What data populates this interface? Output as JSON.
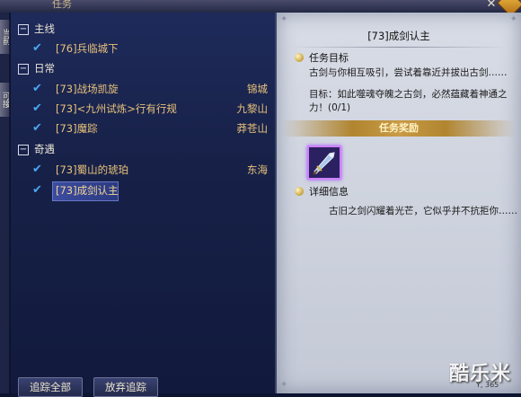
{
  "window": {
    "title_fragment": "任务",
    "close_glyph": "✕"
  },
  "side_tabs": [
    "当前",
    "可接"
  ],
  "categories": [
    {
      "label": "主线",
      "toggle": "−",
      "quests": [
        {
          "title": "[76]兵临城下",
          "location": ""
        }
      ]
    },
    {
      "label": "日常",
      "toggle": "−",
      "quests": [
        {
          "title": "[73]战场凯旋",
          "location": "锦城"
        },
        {
          "title": "[73]<九州试炼>行有行规",
          "location": "九黎山"
        },
        {
          "title": "[73]魔踪",
          "location": "莽苍山"
        }
      ]
    },
    {
      "label": "奇遇",
      "toggle": "−",
      "quests": [
        {
          "title": "[73]蜀山的琥珀",
          "location": "东海"
        },
        {
          "title": "[73]成剑认主",
          "location": ""
        }
      ]
    }
  ],
  "check_glyph": "✔",
  "buttons": {
    "track_all": "追踪全部",
    "abandon_track": "放弃追踪"
  },
  "detail": {
    "header": "[73]成剑认主",
    "objective_label": "任务目标",
    "objective_text": "古剑与你相互吸引，尝试着靠近并拔出古剑……",
    "goal_text": "目标：如此噬魂夺魄之古剑，必然蕴藏着神通之力！(0/1)",
    "reward_label": "任务奖励",
    "detail_label": "详细信息",
    "detail_text": "古旧之剑闪耀着光芒，它似乎并不抗拒你……"
  },
  "watermark": {
    "text": "酷乐米",
    "sub": "Y, 365"
  },
  "colors": {
    "quest_text": "#e9c27a",
    "category_text": "#eae6d6",
    "check": "#4aa8f4",
    "reward_bar": "#c89b46",
    "item_border": "#d080ff"
  }
}
